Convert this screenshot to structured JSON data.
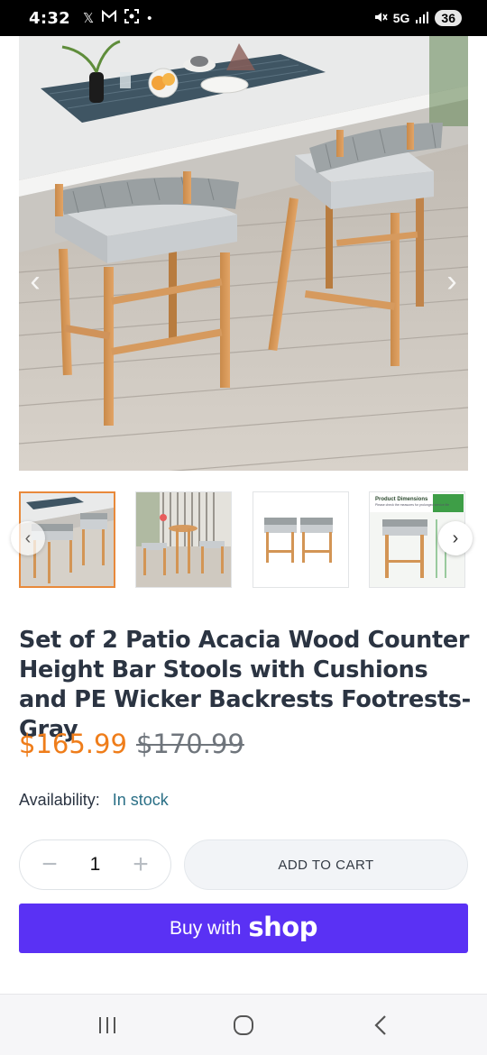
{
  "status_bar": {
    "time": "4:32",
    "left_icons": [
      "x-app-icon",
      "mail-icon",
      "screenshot-icon",
      "dot-icon"
    ],
    "network": "5G",
    "battery": "36"
  },
  "product": {
    "title": "Set of 2 Patio Acacia Wood Counter Height Bar Stools with Cushions and PE Wicker Backrests Footrests-Gray",
    "price": "$165.99",
    "compare_price": "$170.99",
    "availability_label": "Availability:",
    "availability_value": "In stock",
    "thumbnail_count": 4,
    "active_thumbnail": 1,
    "thumb4_heading": "Product Dimensions",
    "thumb4_note": "Please check the measures for prolonged service life"
  },
  "quantity": {
    "value": "1",
    "decrease_symbol": "−",
    "increase_symbol": "+"
  },
  "buttons": {
    "add_to_cart": "ADD TO CART",
    "buy_with": "Buy with",
    "shop_logo": "shop"
  },
  "colors": {
    "price": "#ef7d1a",
    "shop_pay": "#5a31f4",
    "active_thumb_border": "#e8893a",
    "availability": "#2a6f86"
  }
}
